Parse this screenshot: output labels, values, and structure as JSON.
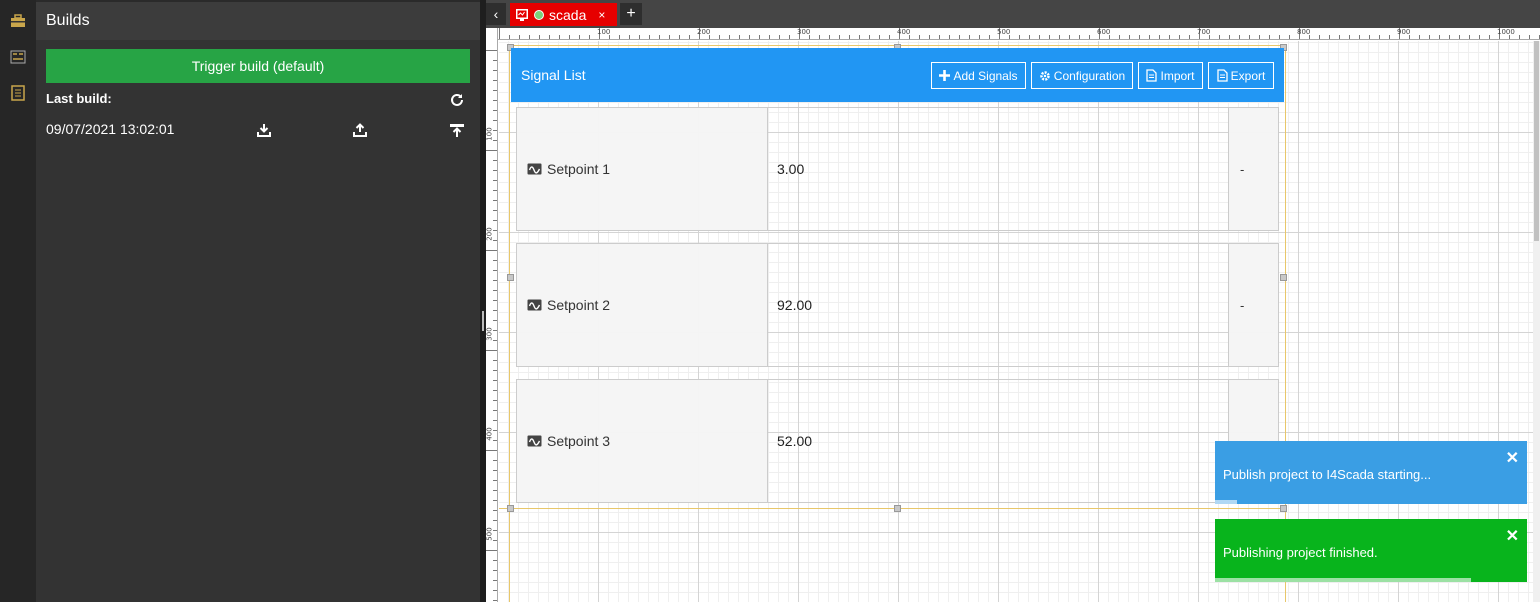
{
  "colors": {
    "accent_blue": "#2196f3",
    "success_green": "#27a445",
    "toast_green": "#08b41c",
    "toast_blue": "#3a9ee4",
    "tab_red": "#e60000",
    "panel_bg": "#333333"
  },
  "rail": {
    "icons": [
      "toolbox-icon",
      "diagram-icon",
      "notebook-icon"
    ]
  },
  "builds": {
    "title": "Builds",
    "trigger_label": "Trigger build (default)",
    "last_build_label": "Last build:",
    "last_build_time": "09/07/2021 13:02:01"
  },
  "tabs": {
    "active_label": "scada",
    "close_glyph": "×",
    "add_glyph": "+",
    "back_glyph": "‹"
  },
  "ruler": {
    "top_labels": [
      "100",
      "200",
      "300",
      "400",
      "500",
      "600",
      "700",
      "800",
      "900",
      "1000"
    ],
    "left_labels": [
      "100",
      "200",
      "300",
      "400",
      "500"
    ]
  },
  "signal_list": {
    "title": "Signal List",
    "buttons": {
      "add": "Add Signals",
      "config": "Configuration",
      "import": "Import",
      "export": "Export"
    },
    "signals": [
      {
        "name": "Setpoint 1",
        "value": "3.00",
        "unit": "-"
      },
      {
        "name": "Setpoint 2",
        "value": "92.00",
        "unit": "-"
      },
      {
        "name": "Setpoint 3",
        "value": "52.00",
        "unit": ""
      }
    ]
  },
  "toasts": [
    {
      "message": "Publish project to I4Scada starting...",
      "close": "✕",
      "progress": 0.07
    },
    {
      "message": "Publishing project finished.",
      "close": "✕",
      "progress": 0.82
    }
  ]
}
